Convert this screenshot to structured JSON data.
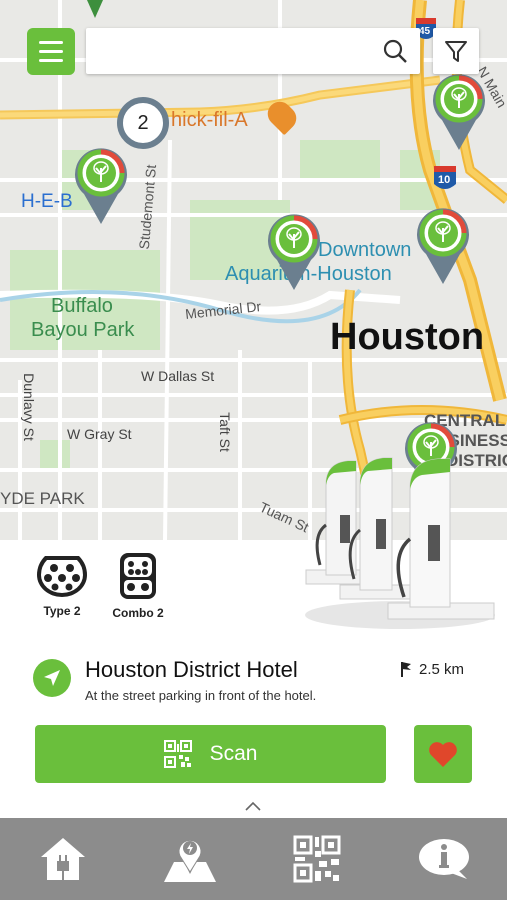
{
  "search": {
    "value": "",
    "placeholder": ""
  },
  "map": {
    "cluster_count": "2",
    "labels": {
      "chickfila": "hick-fil-A",
      "heb": "H-E-B",
      "studemont": "Studemont St",
      "buffalo_1": "Buffalo",
      "buffalo_2": "Bayou Park",
      "memorial": "Memorial Dr",
      "downtown": "Downtown",
      "aquarium": "Aquarium-Houston",
      "houston": "Houston",
      "w_dallas": "W Dallas St",
      "dunlavy": "Dunlavy St",
      "w_gray": "W Gray St",
      "taft": "Taft St",
      "central_1": "CENTRAL",
      "central_2": "BUSINESS",
      "central_3": "DISTRICT",
      "hyde_park": "YDE PARK",
      "tuam": "Tuam St",
      "i45": "45",
      "i10": "10",
      "n_main": "N Main"
    }
  },
  "connectors": [
    {
      "label": "Type 2"
    },
    {
      "label": "Combo 2"
    }
  ],
  "station": {
    "name": "Houston District Hotel",
    "description": "At the street parking in front of the hotel.",
    "distance": "2.5 km"
  },
  "actions": {
    "scan_label": "Scan"
  },
  "colors": {
    "accent": "#6abf3c",
    "navbar": "#8c8c8c",
    "heart": "#e0472b",
    "pin": "#6b7f8f"
  },
  "nav": [
    {
      "icon": "home-charger-icon"
    },
    {
      "icon": "map-pin-icon"
    },
    {
      "icon": "qr-code-icon"
    },
    {
      "icon": "info-icon"
    }
  ]
}
